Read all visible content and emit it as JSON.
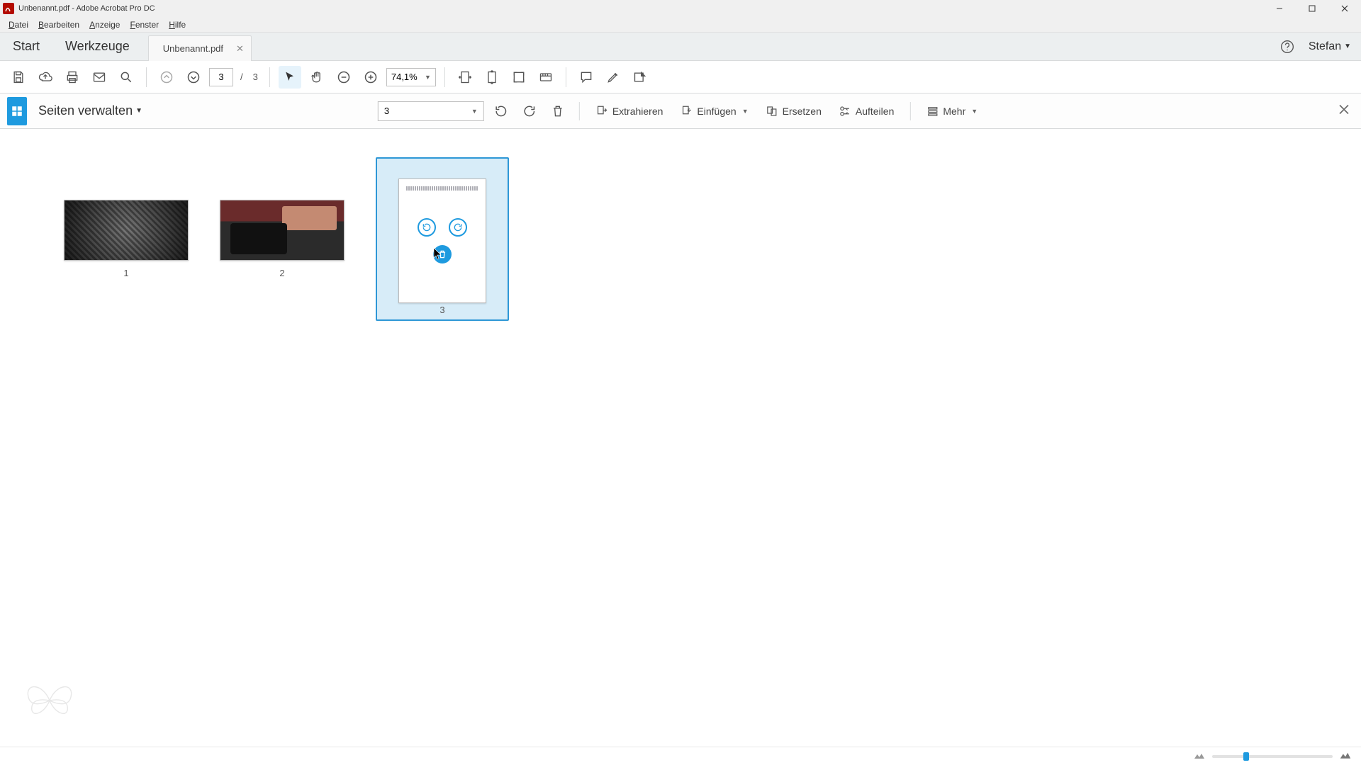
{
  "window": {
    "title": "Unbenannt.pdf - Adobe Acrobat Pro DC"
  },
  "menu": {
    "items": [
      "Datei",
      "Bearbeiten",
      "Anzeige",
      "Fenster",
      "Hilfe"
    ]
  },
  "tabs": {
    "start": "Start",
    "tools": "Werkzeuge",
    "doc": "Unbenannt.pdf"
  },
  "user": {
    "name": "Stefan"
  },
  "toolbar": {
    "page_current": "3",
    "page_total": "3",
    "page_sep": "/",
    "zoom": "74,1%"
  },
  "orgbar": {
    "title": "Seiten verwalten",
    "page_select": "3",
    "extract": "Extrahieren",
    "insert": "Einfügen",
    "replace": "Ersetzen",
    "split": "Aufteilen",
    "more": "Mehr"
  },
  "thumbs": {
    "labels": [
      "1",
      "2",
      "3"
    ]
  }
}
